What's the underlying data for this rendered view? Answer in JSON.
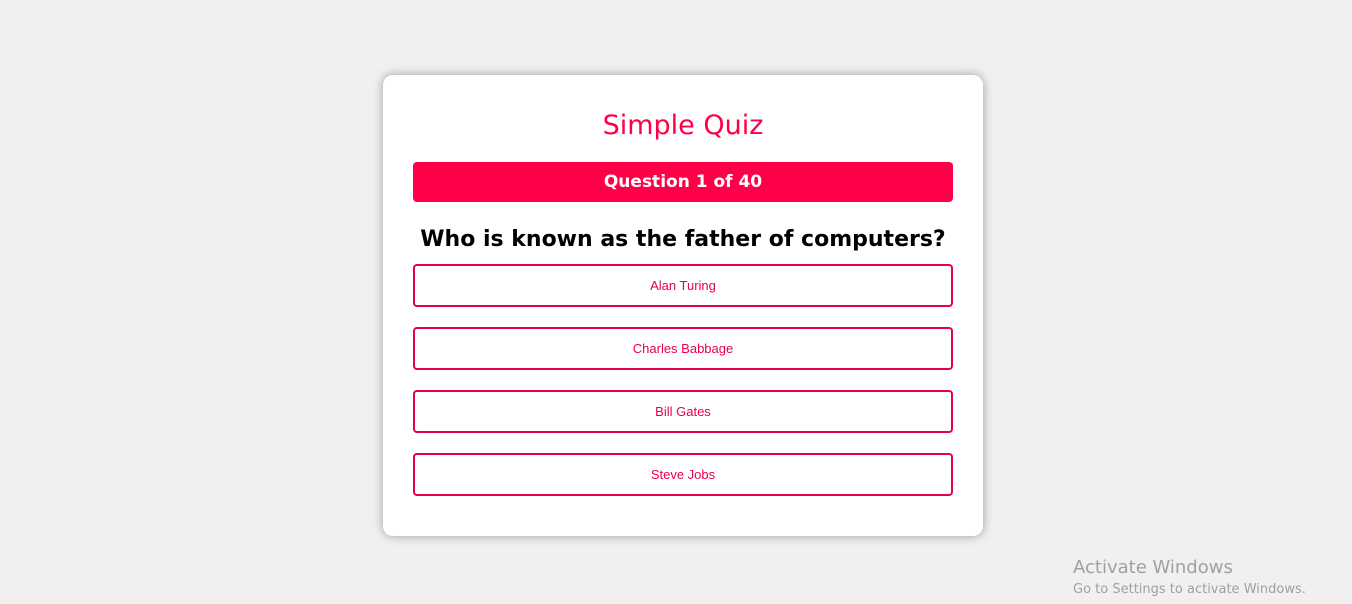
{
  "quiz": {
    "title": "Simple Quiz",
    "progress_label": "Question 1 of 40",
    "question": "Who is known as the father of computers?",
    "options": [
      {
        "label": "Alan Turing"
      },
      {
        "label": "Charles Babbage"
      },
      {
        "label": "Bill Gates"
      },
      {
        "label": "Steve Jobs"
      }
    ]
  },
  "watermark": {
    "title": "Activate Windows",
    "subtitle": "Go to Settings to activate Windows."
  },
  "colors": {
    "accent": "#ff0048",
    "page_background": "#f0f0f0",
    "card_background": "#ffffff"
  }
}
